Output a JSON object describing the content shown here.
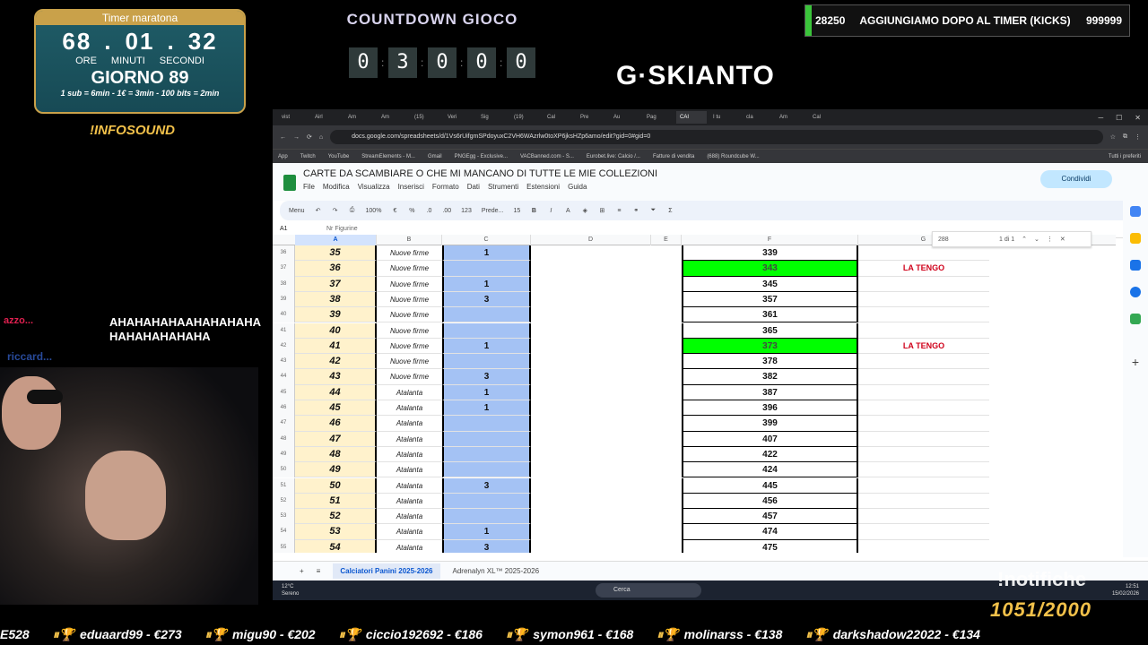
{
  "timer": {
    "title": "Timer maratona",
    "hours": "68",
    "minutes": "01",
    "seconds": "32",
    "unit_h": "ORE",
    "unit_m": "MINUTI",
    "unit_s": "SECONDI",
    "day": "GIORNO 89",
    "rule": "1 sub = 6min - 1€ = 3min - 100 bits = 2min"
  },
  "infosound": "!INFOSOUND",
  "countdown": {
    "title": "COUNTDOWN GIOCO",
    "digits": [
      "0",
      "3",
      "0",
      "0",
      "0"
    ]
  },
  "logo": "G·SKIANTO",
  "kicks": {
    "left": "28250",
    "title": "AGGIUNGIAMO DOPO AL TIMER (KICKS)",
    "right": "999999",
    "progress": 0.03,
    "bar_color": "#3ac43a"
  },
  "chat": {
    "user": "azzo...",
    "message": "AHAHAHAHAAHAHAHAHAHAHAHAHAHAHA",
    "user2": "riccard..."
  },
  "browser": {
    "tabs": [
      "vist",
      "Airl",
      "Am",
      "Am",
      "(15)",
      "Veri",
      "Sig",
      "(19)",
      "Cal",
      "Pre",
      "Au",
      "Pag",
      "CAI",
      "I tu",
      "",
      "cla",
      "Am",
      "Cal"
    ],
    "url": "docs.google.com/spreadsheets/d/1Vs6rUifgmSPdoyuxC2VH6WAzrlw0toXP6jksHZp6amo/edit?gid=0#gid=0",
    "bookmarks": [
      "App",
      "Twitch",
      "YouTube",
      "StreamElements - M...",
      "Gmail",
      "PNGEgg - Exclusive...",
      "VACBanned.com - S...",
      "Eurobet.live: Calcio /...",
      "Fatture di vendita",
      "(688) Roundcube W..."
    ],
    "bookmarks_right": "Tutti i preferiti"
  },
  "sheet": {
    "title": "CARTE DA SCAMBIARE O CHE MI MANCANO DI TUTTE LE MIE COLLEZIONI",
    "menu": [
      "File",
      "Modifica",
      "Visualizza",
      "Inserisci",
      "Formato",
      "Dati",
      "Strumenti",
      "Estensioni",
      "Guida"
    ],
    "share": "Condividi",
    "toolbar": {
      "menu": "Menu",
      "zoom": "100%",
      "euro": "€",
      "percent": "%",
      "dec1": ".0",
      "dec2": ".00",
      "num": "123",
      "font": "Prede...",
      "size": "15",
      "bold": "B",
      "italic": "I"
    },
    "cell_ref": "A1",
    "formula": "Nr Figurine",
    "find": {
      "query": "288",
      "count": "1 di 1"
    },
    "columns": [
      "A",
      "B",
      "C",
      "D",
      "E",
      "F",
      "G"
    ],
    "rows": [
      {
        "n": "36",
        "a": "35",
        "b": "Nuove firme",
        "c": "1",
        "f": "339",
        "g": "",
        "green": false
      },
      {
        "n": "37",
        "a": "36",
        "b": "Nuove firme",
        "c": "",
        "f": "343",
        "g": "LA TENGO",
        "green": true
      },
      {
        "n": "38",
        "a": "37",
        "b": "Nuove firme",
        "c": "1",
        "f": "345",
        "g": "",
        "green": false
      },
      {
        "n": "39",
        "a": "38",
        "b": "Nuove firme",
        "c": "3",
        "f": "357",
        "g": "",
        "green": false
      },
      {
        "n": "40",
        "a": "39",
        "b": "Nuove firme",
        "c": "",
        "f": "361",
        "g": "",
        "green": false
      },
      {
        "n": "41",
        "a": "40",
        "b": "Nuove firme",
        "c": "",
        "f": "365",
        "g": "",
        "green": false
      },
      {
        "n": "42",
        "a": "41",
        "b": "Nuove firme",
        "c": "1",
        "f": "373",
        "g": "LA TENGO",
        "green": true
      },
      {
        "n": "43",
        "a": "42",
        "b": "Nuove firme",
        "c": "",
        "f": "378",
        "g": "",
        "green": false
      },
      {
        "n": "44",
        "a": "43",
        "b": "Nuove firme",
        "c": "3",
        "f": "382",
        "g": "",
        "green": false
      },
      {
        "n": "45",
        "a": "44",
        "b": "Atalanta",
        "c": "1",
        "f": "387",
        "g": "",
        "green": false
      },
      {
        "n": "46",
        "a": "45",
        "b": "Atalanta",
        "c": "1",
        "f": "396",
        "g": "",
        "green": false
      },
      {
        "n": "47",
        "a": "46",
        "b": "Atalanta",
        "c": "",
        "f": "399",
        "g": "",
        "green": false
      },
      {
        "n": "48",
        "a": "47",
        "b": "Atalanta",
        "c": "",
        "f": "407",
        "g": "",
        "green": false
      },
      {
        "n": "49",
        "a": "48",
        "b": "Atalanta",
        "c": "",
        "f": "422",
        "g": "",
        "green": false
      },
      {
        "n": "50",
        "a": "49",
        "b": "Atalanta",
        "c": "",
        "f": "424",
        "g": "",
        "green": false
      },
      {
        "n": "51",
        "a": "50",
        "b": "Atalanta",
        "c": "3",
        "f": "445",
        "g": "",
        "green": false
      },
      {
        "n": "52",
        "a": "51",
        "b": "Atalanta",
        "c": "",
        "f": "456",
        "g": "",
        "green": false
      },
      {
        "n": "53",
        "a": "52",
        "b": "Atalanta",
        "c": "",
        "f": "457",
        "g": "",
        "green": false
      },
      {
        "n": "54",
        "a": "53",
        "b": "Atalanta",
        "c": "1",
        "f": "474",
        "g": "",
        "green": false
      },
      {
        "n": "55",
        "a": "54",
        "b": "Atalanta",
        "c": "3",
        "f": "475",
        "g": "",
        "green": false
      }
    ],
    "sheet_tabs": [
      "Calciatori Panini 2025-2026",
      "Adrenalyn XL™ 2025-2026"
    ]
  },
  "taskbar": {
    "weather_temp": "12°C",
    "weather_desc": "Sereno",
    "search": "Cerca",
    "time": "12:51",
    "date": "15/02/2026"
  },
  "notifiche": "!notifiche",
  "counter": "1051/2000",
  "ticker": [
    "E528",
    "eduaard99 - €273",
    "migu90 - €202",
    "ciccio192692 - €186",
    "symon961 - €168",
    "molinarss - €138",
    "darkshadow22022 - €134"
  ]
}
